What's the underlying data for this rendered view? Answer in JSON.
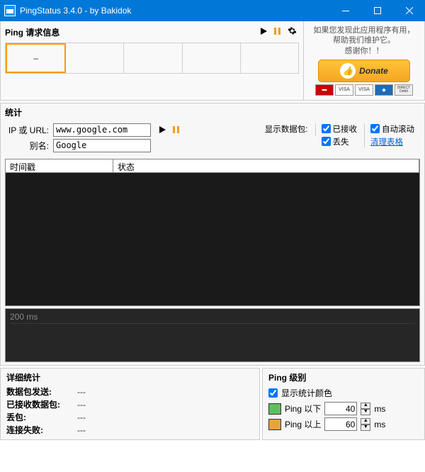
{
  "titlebar": {
    "title": "PingStatus 3.4.0 - by Bakidok"
  },
  "ping_panel": {
    "label": "Ping 请求信息",
    "cells": [
      "–",
      "",
      "",
      "",
      ""
    ]
  },
  "donate": {
    "line1": "如果您发现此应用程序有用，",
    "line2": "帮助我们维护它。",
    "line3": "感谢你！！",
    "button": "Donate",
    "cards": [
      "MC",
      "VISA",
      "VISA",
      "AMEX",
      "DIRECT Debit"
    ]
  },
  "stats": {
    "title": "统计",
    "ip_label": "IP 或 URL:",
    "ip_value": "www.google.com",
    "alias_label": "别名:",
    "alias_value": "Google",
    "show_packets_label": "显示数据包:",
    "received_label": "已接收",
    "lost_label": "丢失",
    "autoscroll_label": "自动滚动",
    "clear_label": "清理表格",
    "col_timestamp": "时间戳",
    "col_status": "状态",
    "graph_label": "200 ms"
  },
  "detail": {
    "title": "详细统计",
    "rows": [
      {
        "label": "数据包发送:",
        "value": "---"
      },
      {
        "label": "已接收数据包:",
        "value": "---"
      },
      {
        "label": "丢包:",
        "value": "---"
      },
      {
        "label": "连接失败:",
        "value": "---"
      }
    ]
  },
  "level": {
    "title": "Ping 级别",
    "show_color_label": "显示统计颜色",
    "below_label": "Ping 以下",
    "below_value": "40",
    "above_label": "Ping 以上",
    "above_value": "60",
    "unit": "ms"
  }
}
